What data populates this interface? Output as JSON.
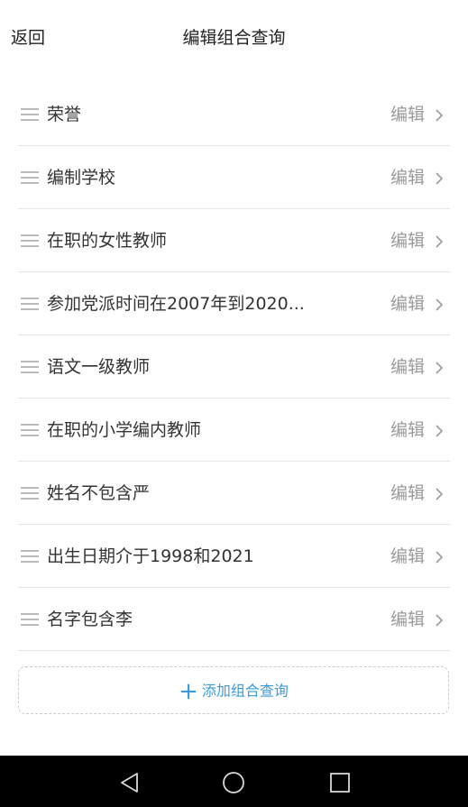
{
  "header": {
    "back_label": "返回",
    "title": "编辑组合查询"
  },
  "items": [
    {
      "label": "荣誉",
      "edit": "编辑"
    },
    {
      "label": "编制学校",
      "edit": "编辑"
    },
    {
      "label": "在职的女性教师",
      "edit": "编辑"
    },
    {
      "label": "参加党派时间在2007年到2020...",
      "edit": "编辑"
    },
    {
      "label": "语文一级教师",
      "edit": "编辑"
    },
    {
      "label": "在职的小学编内教师",
      "edit": "编辑"
    },
    {
      "label": "姓名不包含严",
      "edit": "编辑"
    },
    {
      "label": "出生日期介于1998和2021",
      "edit": "编辑"
    },
    {
      "label": "名字包含李",
      "edit": "编辑"
    }
  ],
  "add_button": {
    "icon": "plus-icon",
    "label": "添加组合查询"
  },
  "nav": {
    "icons": [
      "back-triangle-icon",
      "home-circle-icon",
      "recents-square-icon"
    ]
  },
  "colors": {
    "accent": "#3a9bd8",
    "edit_text": "#9a9a9a",
    "navbar": "#000000"
  }
}
